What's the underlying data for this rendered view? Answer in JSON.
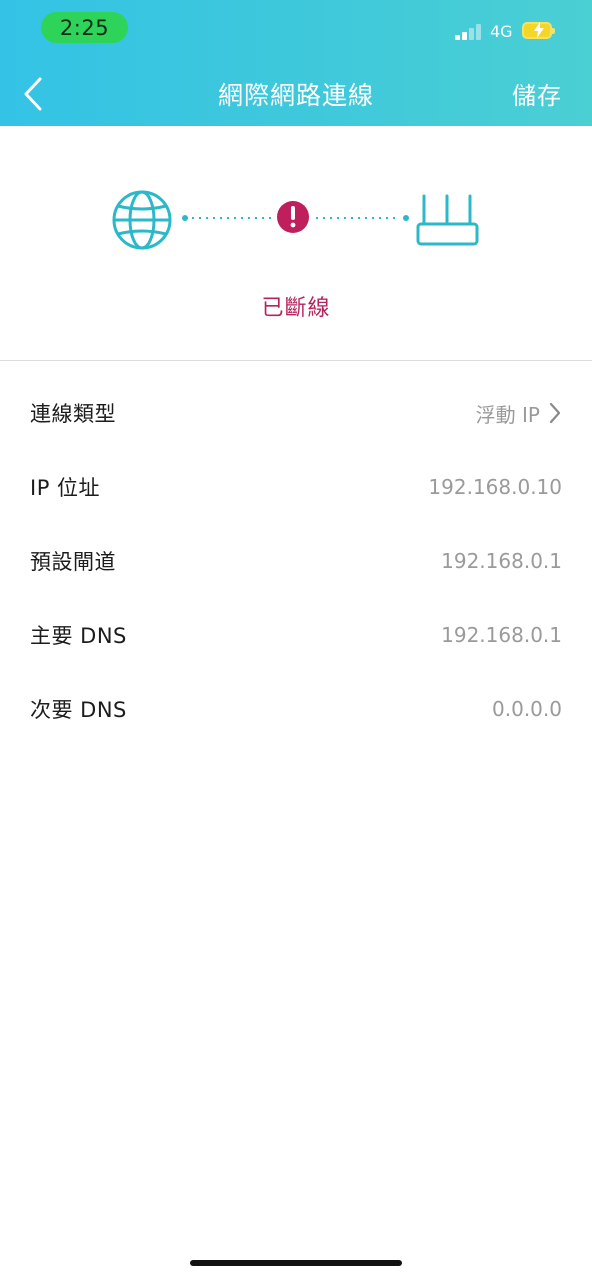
{
  "status_bar": {
    "time": "2:25",
    "network": "4G"
  },
  "header": {
    "title": "網際網路連線",
    "save_label": "儲存"
  },
  "connection": {
    "status": "已斷線",
    "status_color": "#b5245e",
    "accent_color": "#2bb8c9"
  },
  "settings": {
    "rows": [
      {
        "label": "連線類型",
        "value": "浮動 IP"
      },
      {
        "label": "IP 位址",
        "value": "192.168.0.10"
      },
      {
        "label": "預設閘道",
        "value": "192.168.0.1"
      },
      {
        "label": "主要 DNS",
        "value": "192.168.0.1"
      },
      {
        "label": "次要 DNS",
        "value": "0.0.0.0"
      }
    ]
  }
}
